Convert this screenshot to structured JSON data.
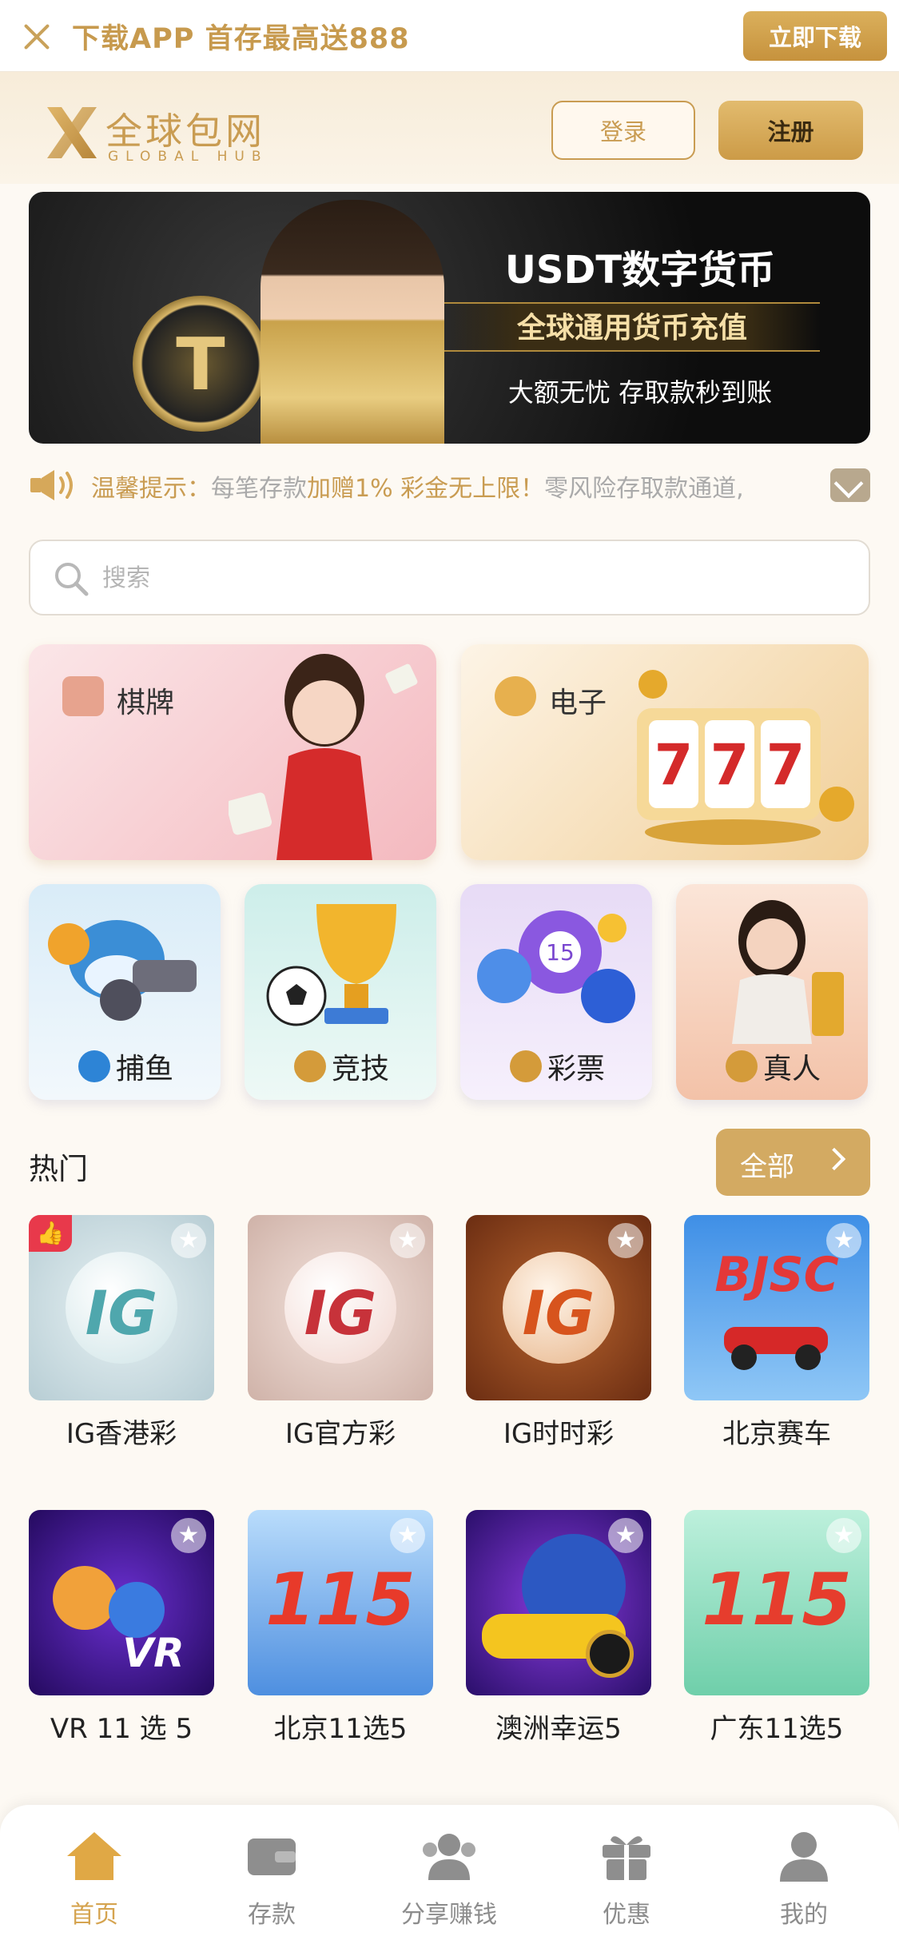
{
  "topbar": {
    "promo": "下载APP 首存最高送888",
    "download_button": "立即下载"
  },
  "header": {
    "logo_cn": "全球包网",
    "logo_en": "GLOBAL HUB",
    "login_button": "登录",
    "register_button": "注册"
  },
  "banner": {
    "title": "USDT数字货币",
    "subtitle": "全球通用货币充值",
    "line": "大额无忧 存取款秒到账"
  },
  "notice": {
    "prefix": "温馨提示：",
    "part1": "每笔存款",
    "highlight": "加赠1% 彩金无上限！",
    "part2": "零风险存取款通道,"
  },
  "search": {
    "placeholder": "搜索"
  },
  "categories": {
    "big": [
      {
        "label": "棋牌"
      },
      {
        "label": "电子"
      }
    ],
    "small": [
      {
        "label": "捕鱼"
      },
      {
        "label": "竞技"
      },
      {
        "label": "彩票"
      },
      {
        "label": "真人"
      }
    ]
  },
  "hot": {
    "title": "热门",
    "all_button": "全部",
    "games": [
      {
        "name": "IG香港彩",
        "logo_text": "IG"
      },
      {
        "name": "IG官方彩",
        "logo_text": "IG"
      },
      {
        "name": "IG时时彩",
        "logo_text": "IG"
      },
      {
        "name": "北京赛车",
        "logo_text": "BJSC"
      },
      {
        "name": "VR 11 选 5",
        "logo_text": "VR"
      },
      {
        "name": "北京11选5",
        "logo_text": "115"
      },
      {
        "name": "澳洲幸运5",
        "logo_text": ""
      },
      {
        "name": "广东11选5",
        "logo_text": "115"
      }
    ]
  },
  "bottom_nav": [
    {
      "label": "首页",
      "icon": "home-icon",
      "active": true
    },
    {
      "label": "存款",
      "icon": "wallet-icon"
    },
    {
      "label": "分享赚钱",
      "icon": "share-users-icon"
    },
    {
      "label": "优惠",
      "icon": "gift-icon"
    },
    {
      "label": "我的",
      "icon": "profile-icon"
    }
  ],
  "colors": {
    "accent": "#c99c52",
    "accent_dark": "#c6923d",
    "nav_active": "#d5a450",
    "hot_badge": "#e8394b"
  }
}
